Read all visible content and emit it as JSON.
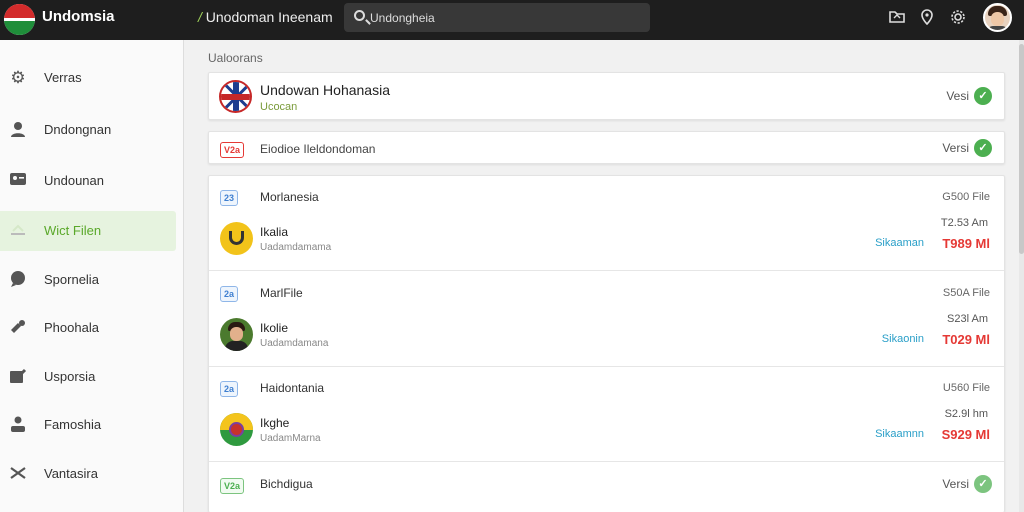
{
  "header": {
    "brand": "Undomsia",
    "section_slash": "/",
    "section": "Unodoman Ineenam",
    "search_value": "Undongheia"
  },
  "sidebar": {
    "items": [
      {
        "label": "Verras",
        "icon": "gear-icon"
      },
      {
        "label": "Dndongnan",
        "icon": "user-icon"
      },
      {
        "label": "Undounan",
        "icon": "id-card-icon"
      },
      {
        "label": "Wict Filen",
        "icon": "file-icon",
        "active": true
      },
      {
        "label": "Spornelia",
        "icon": "chat-icon"
      },
      {
        "label": "Phoohala",
        "icon": "tools-icon"
      },
      {
        "label": "Usporsia",
        "icon": "edit-icon"
      },
      {
        "label": "Famoshia",
        "icon": "person-icon"
      },
      {
        "label": "Vantasira",
        "icon": "shuffle-icon"
      }
    ]
  },
  "main": {
    "section_title": "Ualoorans",
    "hero": {
      "title": "Undowan Hohanasia",
      "subtitle": "Ucocan",
      "verify": "Vesi"
    },
    "strip": {
      "badge": "V2a",
      "label": "Eiodioe Ileldondoman",
      "verify": "Versi"
    },
    "rows": [
      {
        "badge": "23",
        "title": "Morlanesia",
        "name": "Ikalia",
        "sub": "Uadamdamama",
        "size": "G500 File",
        "time": "T2.53 Am",
        "link": "Sikaaman",
        "amount": "T989 Ml"
      },
      {
        "badge": "2a",
        "title": "MarlFile",
        "name": "Ikolie",
        "sub": "Uadamdamana",
        "size": "S50A File",
        "time": "S23l Am",
        "link": "Sikaonin",
        "amount": "T029 Ml"
      },
      {
        "badge": "2a",
        "title": "Haidontania",
        "name": "Ikghe",
        "sub": "UadamMarna",
        "size": "U560 File",
        "time": "S2.9l hm",
        "link": "Sikaamnn",
        "amount": "S929 Ml"
      }
    ],
    "last_row": {
      "badge": "V2a",
      "title": "Bichdigua",
      "verify": "Versi"
    }
  }
}
